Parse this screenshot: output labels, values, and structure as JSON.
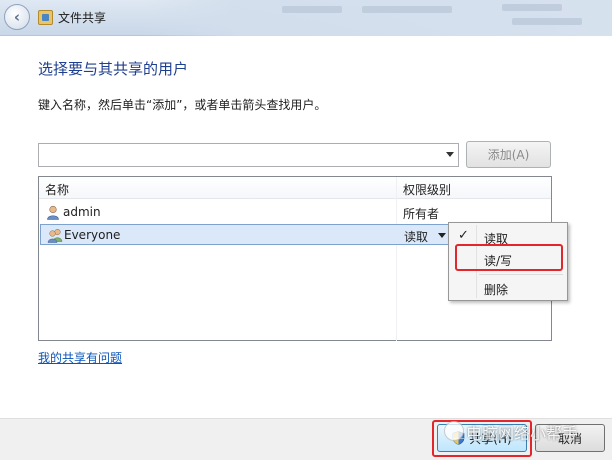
{
  "window": {
    "title": "文件共享"
  },
  "main": {
    "heading": "选择要与其共享的用户",
    "instruction": "键入名称，然后单击“添加”，或者单击箭头查找用户。",
    "name_input": {
      "value": ""
    },
    "add_button": "添加(A)",
    "list": {
      "columns": [
        "名称",
        "权限级别"
      ],
      "rows": [
        {
          "name": "admin",
          "permission": "所有者",
          "icon": "user-icon"
        },
        {
          "name": "Everyone",
          "permission": "读取",
          "icon": "group-icon",
          "selected": true
        }
      ]
    },
    "problem_link": "我的共享有问题"
  },
  "context_menu": {
    "items": [
      "读取",
      "读/写",
      "删除"
    ],
    "checked_index": 0,
    "highlighted_index": 1,
    "check_mark": "✓"
  },
  "footer": {
    "share_button": "共享(H)",
    "cancel_button": "取消"
  },
  "watermark": "电脑网络小帮手",
  "colors": {
    "heading": "#1f3f8f",
    "link": "#0b55b7",
    "highlight_box": "#e3262b",
    "selected_row": "#dbe8f9"
  }
}
